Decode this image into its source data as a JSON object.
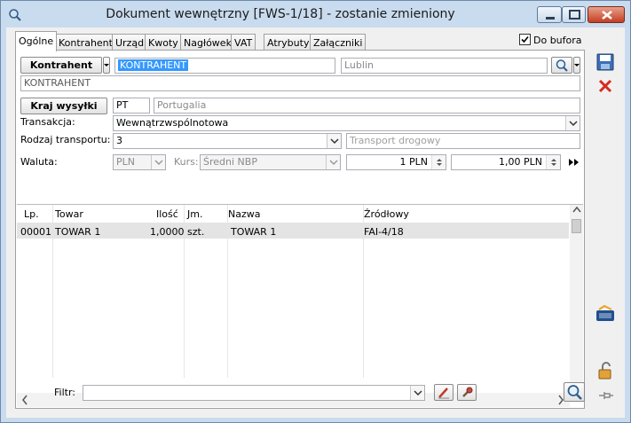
{
  "window": {
    "title": "Dokument wewnętrzny [FWS-1/18]  - zostanie zmieniony",
    "minimize_icon": "minimize-icon",
    "maximize_icon": "maximize-icon",
    "close_icon": "close-icon"
  },
  "tabs": [
    {
      "label": "Ogólne",
      "active": true
    },
    {
      "label": "Kontrahent"
    },
    {
      "label": "Urząd"
    },
    {
      "label": "Kwoty"
    },
    {
      "label": "Nagłówek"
    },
    {
      "label": "VAT"
    },
    {
      "label": "Atrybuty"
    },
    {
      "label": "Załączniki"
    }
  ],
  "do_bufora": {
    "label": "Do bufora",
    "checked": true
  },
  "kontrahent": {
    "button_label": "Kontrahent",
    "code": "KONTRAHENT",
    "city": "Lublin",
    "name": "KONTRAHENT"
  },
  "kraj_wysylki": {
    "button_label": "Kraj wysyłki",
    "code": "PT",
    "name": "Portugalia"
  },
  "transakcja": {
    "label": "Transakcja:",
    "value": "Wewnątrzwspólnotowa"
  },
  "rodzaj_transportu": {
    "label": "Rodzaj transportu:",
    "value": "3",
    "desc": "Transport drogowy"
  },
  "waluta": {
    "label": "Waluta:",
    "value": "PLN",
    "kurs_label": "Kurs:",
    "kurs_value": "Średni NBP",
    "rate_from": "1 PLN",
    "rate_to": "1,00 PLN"
  },
  "grid": {
    "columns": [
      "Lp.",
      "Towar",
      "Ilość",
      "Jm.",
      "Nazwa",
      "Źródłowy"
    ],
    "rows": [
      [
        "00001",
        "TOWAR 1",
        "1,0000",
        "szt.",
        "TOWAR 1",
        "FAI-4/18"
      ]
    ]
  },
  "filtr": {
    "label": "Filtr:",
    "value": ""
  },
  "colors": {
    "selection": "#3399ff",
    "frame": "#c9dbee"
  }
}
